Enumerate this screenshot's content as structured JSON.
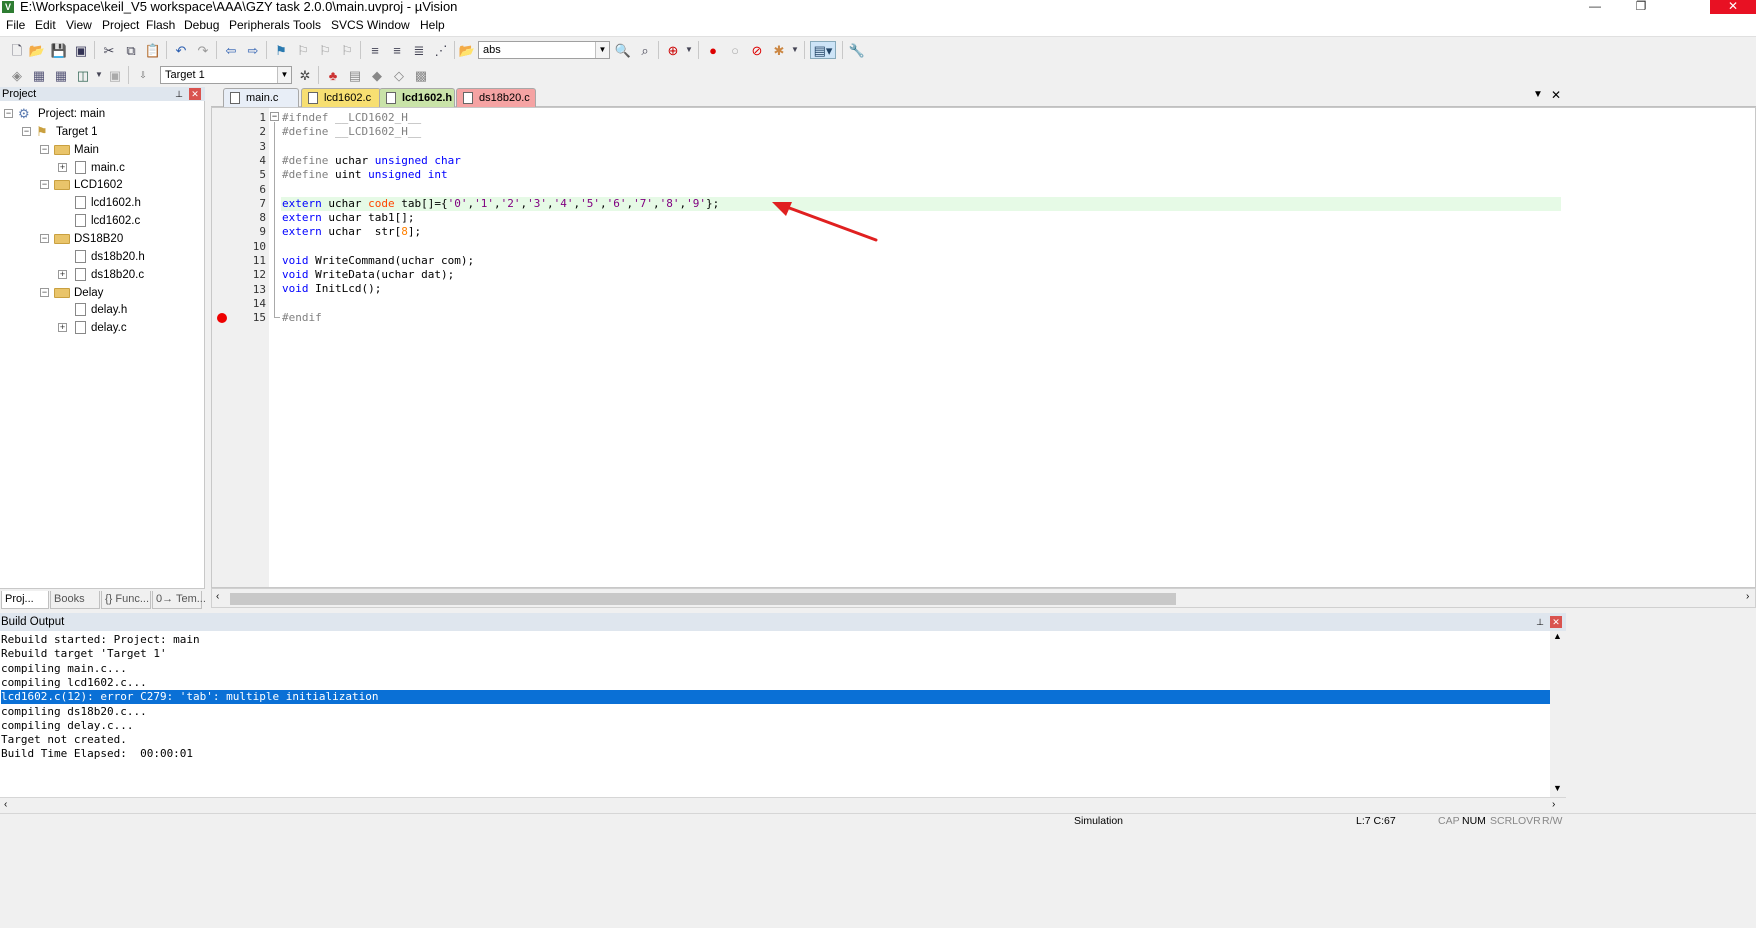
{
  "window": {
    "title": "E:\\Workspace\\keil_V5 workspace\\AAA\\GZY task 2.0.0\\main.uvproj - µVision",
    "icon_letter": "V",
    "minimize": "—",
    "restore": "❐",
    "close": "✕"
  },
  "menu": [
    "File",
    "Edit",
    "View",
    "Project",
    "Flash",
    "Debug",
    "Peripherals",
    "Tools",
    "SVCS",
    "Window",
    "Help"
  ],
  "toolbar": {
    "find_combo_value": "abs",
    "target_combo_value": "Target 1"
  },
  "project_panel": {
    "title": "Project",
    "pin": "📌",
    "close": "✕",
    "tree": [
      {
        "label": "Project: main",
        "level": 0,
        "type": "project",
        "exp": "−"
      },
      {
        "label": "Target 1",
        "level": 1,
        "type": "target",
        "exp": "−"
      },
      {
        "label": "Main",
        "level": 2,
        "type": "folder",
        "exp": "−"
      },
      {
        "label": "main.c",
        "level": 3,
        "type": "file",
        "exp": "+"
      },
      {
        "label": "LCD1602",
        "level": 2,
        "type": "folder",
        "exp": "−"
      },
      {
        "label": "lcd1602.h",
        "level": 3,
        "type": "file",
        "exp": ""
      },
      {
        "label": "lcd1602.c",
        "level": 3,
        "type": "file",
        "exp": ""
      },
      {
        "label": "DS18B20",
        "level": 2,
        "type": "folder",
        "exp": "−"
      },
      {
        "label": "ds18b20.h",
        "level": 3,
        "type": "file",
        "exp": ""
      },
      {
        "label": "ds18b20.c",
        "level": 3,
        "type": "file",
        "exp": "+"
      },
      {
        "label": "Delay",
        "level": 2,
        "type": "folder",
        "exp": "−"
      },
      {
        "label": "delay.h",
        "level": 3,
        "type": "file",
        "exp": ""
      },
      {
        "label": "delay.c",
        "level": 3,
        "type": "file",
        "exp": "+"
      }
    ],
    "tabs": [
      "Proj...",
      "Books",
      "{} Func...",
      "0→ Tem..."
    ]
  },
  "editor_tabs": [
    {
      "label": "main.c",
      "color": "#e8eef7"
    },
    {
      "label": "lcd1602.c",
      "color": "#f7df72"
    },
    {
      "label": "lcd1602.h",
      "color": "#c9e3a8"
    },
    {
      "label": "ds18b20.c",
      "color": "#f5a3a3"
    }
  ],
  "editor": {
    "active_file": "lcd1602.h",
    "highlighted_line": 7,
    "breakpoint_line": 15,
    "line_numbers": [
      "1",
      "2",
      "3",
      "4",
      "5",
      "6",
      "7",
      "8",
      "9",
      "10",
      "11",
      "12",
      "13",
      "14",
      "15"
    ]
  },
  "build_output": {
    "title": "Build Output",
    "lines": [
      "Rebuild started: Project: main",
      "Rebuild target 'Target 1'",
      "compiling main.c...",
      "compiling lcd1602.c...",
      "lcd1602.c(12): error C279: 'tab': multiple initialization",
      "compiling ds18b20.c...",
      "compiling delay.c...",
      "Target not created.",
      "Build Time Elapsed:  00:00:01"
    ],
    "selected_index": 4
  },
  "status": {
    "mode": "Simulation",
    "cursor": "L:7 C:67",
    "cap": "CAP",
    "num": "NUM",
    "scrl": "SCRL",
    "ovr": "OVR",
    "rw": "R/W"
  },
  "colors": {
    "selection": "#0a70d6",
    "highlight_line": "#e6fae6",
    "breakpoint": "#e00000",
    "arrow": "#e02020"
  }
}
